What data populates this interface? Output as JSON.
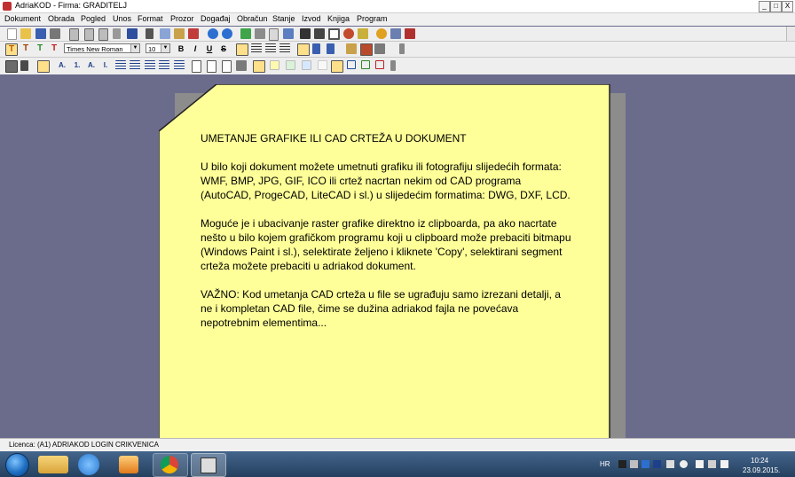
{
  "window": {
    "title": "AdriaKOD - Firma: GRADITELJ",
    "controls": [
      "_",
      "□",
      "X"
    ]
  },
  "menu": [
    "Dokument",
    "Obrada",
    "Pogled",
    "Unos",
    "Format",
    "Prozor",
    "Događaj",
    "Obračun",
    "Stanje",
    "Izvod",
    "Knjiga",
    "Program"
  ],
  "format_toolbar": {
    "text_style_buttons": [
      "T",
      "T",
      "T",
      "T"
    ],
    "font_name": "Times New Roman",
    "font_size": "10",
    "style_buttons": [
      "B",
      "I",
      "U",
      "S"
    ]
  },
  "list_toolbar": {
    "list_buttons": [
      "A.",
      "1.",
      "A.",
      "I."
    ]
  },
  "document": {
    "heading": "UMETANJE GRAFIKE ILI CAD CRTEŽA U DOKUMENT",
    "paragraph1": "U bilo koji dokument možete umetnuti grafiku ili fotografiju slijedećih formata: WMF, BMP, JPG, GIF, ICO ili crtež nacrtan nekim od CAD programa (AutoCAD, ProgeCAD, LiteCAD i sl.) u slijedećim formatima: DWG, DXF, LCD.",
    "paragraph2": "Moguće je i ubacivanje raster grafike direktno iz clipboarda, pa ako nacrtate nešto u bilo kojem grafičkom programu koji u clipboard može prebaciti bitmapu (Windows Paint i sl.), selektirate željeno i kliknete 'Copy', selektirani segment crteža možete prebaciti u adriakod dokument.",
    "paragraph3": "VAŽNO: Kod umetanja CAD crteža u file se ugrađuju samo izrezani detalji, a ne i kompletan CAD file, čime se dužina adriakod fajla ne povećava nepotrebnim elementima..."
  },
  "status": {
    "license": "Licenca: (A1) ADRIAKOD LOGIN CRIKVENICA"
  },
  "taskbar": {
    "language": "HR",
    "time": "10:24",
    "date": "23.09.2015."
  },
  "colors": {
    "note_fill": "#ffff99",
    "workspace": "#6b6b8c",
    "taskbar": "#24405f"
  }
}
